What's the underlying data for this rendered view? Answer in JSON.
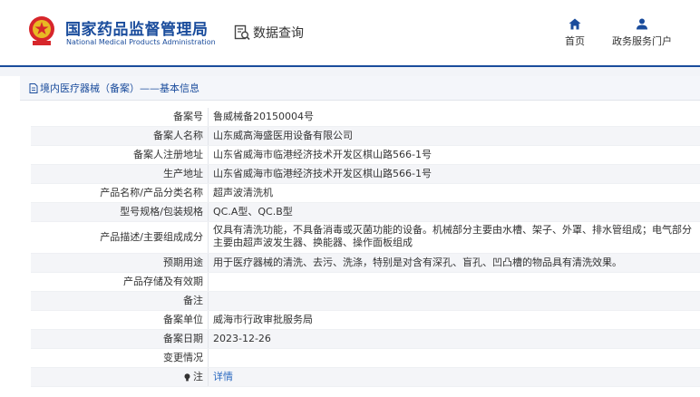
{
  "header": {
    "org_name_cn": "国家药品监督管理局",
    "org_name_en": "National Medical Products Administration",
    "query_label": "数据查询",
    "nav": [
      {
        "label": "首页",
        "icon": "home-icon"
      },
      {
        "label": "政务服务门户",
        "icon": "user-icon"
      }
    ]
  },
  "breadcrumb": {
    "text": "境内医疗器械（备案）——基本信息",
    "icon": "document-icon"
  },
  "record": {
    "rows": [
      {
        "label": "备案号",
        "value": "鲁威械备20150004号"
      },
      {
        "label": "备案人名称",
        "value": "山东威高海盛医用设备有限公司"
      },
      {
        "label": "备案人注册地址",
        "value": "山东省威海市临港经济技术开发区棋山路566-1号"
      },
      {
        "label": "生产地址",
        "value": "山东省威海市临港经济技术开发区棋山路566-1号"
      },
      {
        "label": "产品名称/产品分类名称",
        "value": "超声波清洗机"
      },
      {
        "label": "型号规格/包装规格",
        "value": "QC.A型、QC.B型"
      },
      {
        "label": "产品描述/主要组成成分",
        "value": "仅具有清洗功能，不具备消毒或灭菌功能的设备。机械部分主要由水槽、架子、外罩、排水管组成；电气部分主要由超声波发生器、换能器、操作面板组成"
      },
      {
        "label": "预期用途",
        "value": "用于医疗器械的清洗、去污、洗涤，特别是对含有深孔、盲孔、凹凸槽的物品具有清洗效果。"
      },
      {
        "label": "产品存储及有效期",
        "value": ""
      },
      {
        "label": "备注",
        "value": ""
      },
      {
        "label": "备案单位",
        "value": "威海市行政审批服务局"
      },
      {
        "label": "备案日期",
        "value": "2023-12-26"
      },
      {
        "label": "变更情况",
        "value": ""
      },
      {
        "label": "注",
        "value": "详情"
      }
    ]
  },
  "colors": {
    "brand": "#1a4c9c",
    "link": "#2a69c0",
    "row_alt": "#f4f5f8"
  }
}
